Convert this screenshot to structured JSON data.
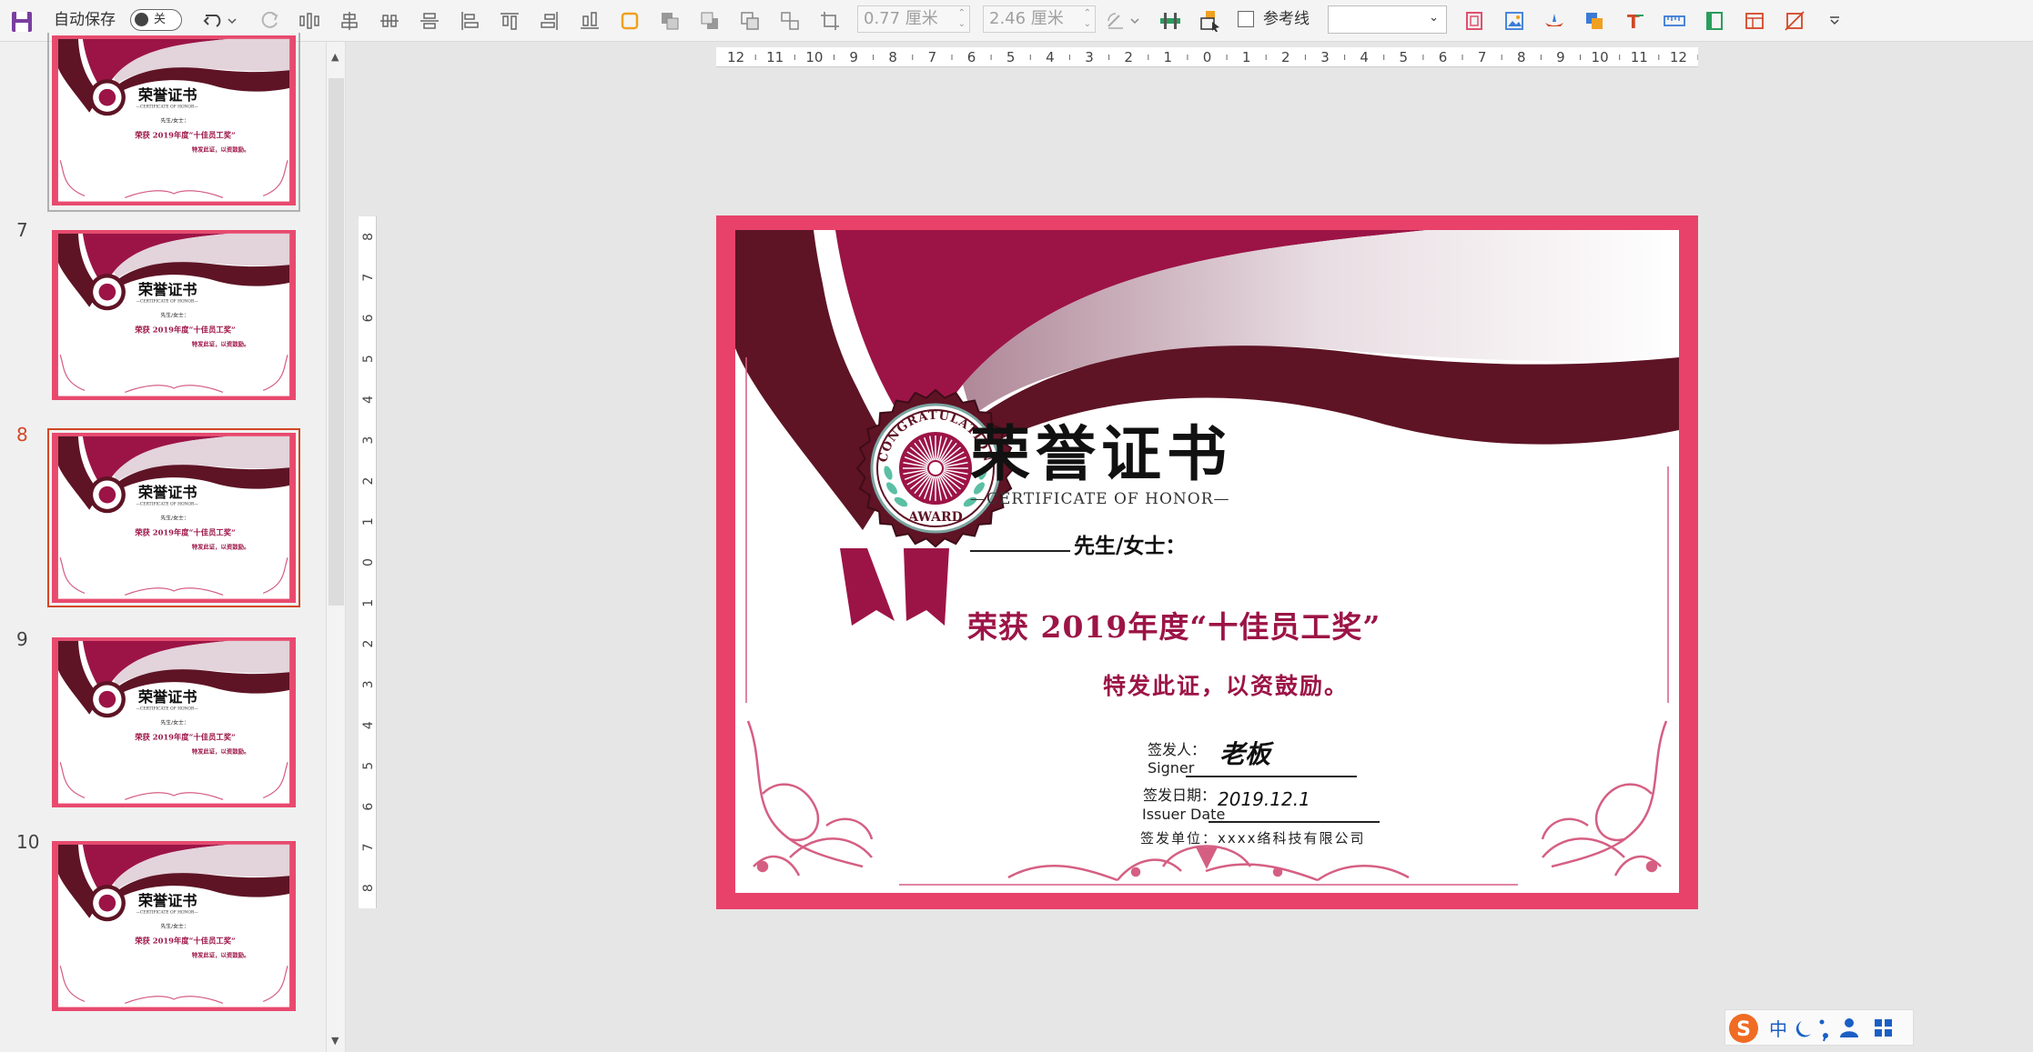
{
  "toolbar": {
    "autosave_label": "自动保存",
    "autosave_state": "关",
    "left_offset_value": "0.77 厘米",
    "top_offset_value": "2.46 厘米",
    "guides_label": "参考线",
    "font_select_value": ""
  },
  "thumbnails": {
    "slides": [
      {
        "number": "",
        "active": false
      },
      {
        "number": "7",
        "active": false
      },
      {
        "number": "8",
        "active": true
      },
      {
        "number": "9",
        "active": false
      },
      {
        "number": "10",
        "active": false
      }
    ],
    "title": "荣誉证书",
    "subtitle": "—CERTIFICATE OF HONOR—",
    "recipient": "先生/女士：",
    "award": "荣获 2019年度“十佳员工奖”",
    "issue": "特发此证，以资鼓励。"
  },
  "ruler": {
    "horizontal": [
      "12",
      "11",
      "10",
      "9",
      "8",
      "7",
      "6",
      "5",
      "4",
      "3",
      "2",
      "1",
      "0",
      "1",
      "2",
      "3",
      "4",
      "5",
      "6",
      "7",
      "8",
      "9",
      "10",
      "11",
      "12"
    ],
    "vertical": [
      "8",
      "7",
      "6",
      "5",
      "4",
      "3",
      "2",
      "1",
      "0",
      "1",
      "2",
      "3",
      "4",
      "5",
      "6",
      "7",
      "8"
    ]
  },
  "certificate": {
    "title": "荣誉证书",
    "subtitle": "—CERTIFICATE OF HONOR—",
    "recipient_suffix": "先生/女士：",
    "award_line": "荣获 2019年度“十佳员工奖”",
    "issue_line": "特发此证，以资鼓励。",
    "badge_top_text": "CONGRATULATION",
    "badge_bottom_text": "AWARD",
    "signer_label_cn": "签发人：",
    "signer_label_en": "Signer",
    "signer_value": "老板",
    "date_label_cn": "签发日期：",
    "date_label_en": "Issuer Date",
    "date_value": "2019.12.1",
    "unit_line": "签发单位：xxxx络科技有限公司"
  },
  "ime": {
    "mode": "中"
  },
  "colors": {
    "frame": "#e8426a",
    "wine": "#9c1446",
    "dark_wine": "#5e1425",
    "accent_orange": "#d24726"
  }
}
